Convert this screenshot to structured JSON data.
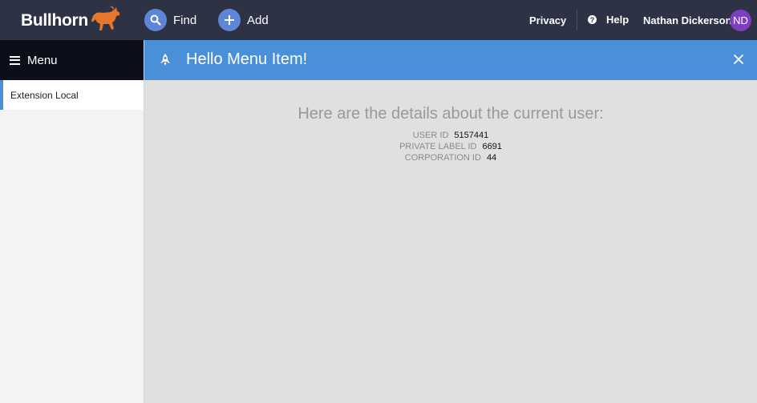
{
  "brand": {
    "name": "Bullhorn",
    "accent": "#e8772e"
  },
  "topbar": {
    "find_label": "Find",
    "add_label": "Add",
    "privacy_label": "Privacy",
    "help_label": "Help",
    "user_name": "Nathan Dickerson",
    "avatar_initials": "ND",
    "background": "#2e3245"
  },
  "sidebar": {
    "menu_label": "Menu",
    "items": [
      {
        "label": "Extension Local",
        "active": true
      }
    ]
  },
  "main": {
    "title": "Hello Menu Item!",
    "header_color": "#4a90d9",
    "heading": "Here are the details about the current user:",
    "details": [
      {
        "label": "User ID",
        "value": "5157441"
      },
      {
        "label": "Private Label ID",
        "value": "6691"
      },
      {
        "label": "Corporation ID",
        "value": "44"
      }
    ]
  },
  "icons": {
    "find": "search-icon",
    "add": "plus-icon",
    "help": "help-icon",
    "menu": "hamburger-icon",
    "title": "rocket-icon",
    "close": "close-icon"
  }
}
